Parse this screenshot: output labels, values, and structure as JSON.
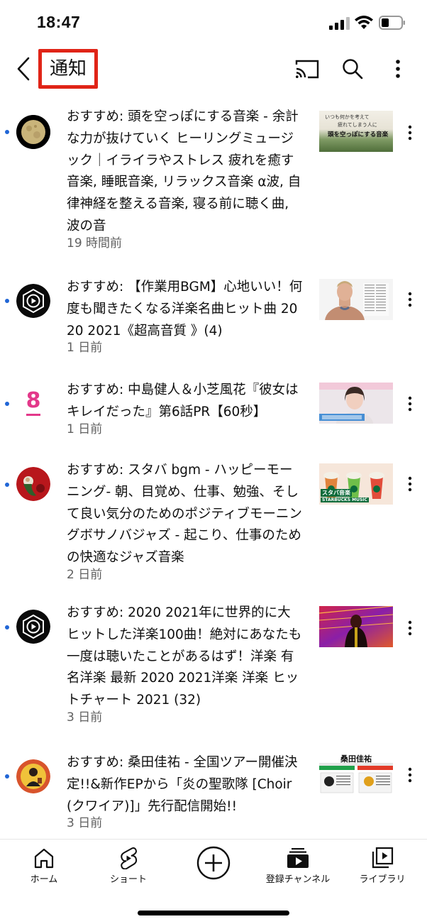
{
  "status_bar": {
    "time": "18:47"
  },
  "header": {
    "title": "通知"
  },
  "notifications": [
    {
      "text": "おすすめ: 頭を空っぽにする音楽 - 余計な力が抜けていく ヒーリングミュージック｜イライラやストレス 疲れを癒す音楽, 睡眠音楽, リラックス音楽 α波, 自律神経を整える音楽, 寝る前に聴く曲, 波の音",
      "time": "19 時間前",
      "thumb_text_1": "いつも何かを考えて",
      "thumb_text_2": "疲れてしまう人に",
      "thumb_text_3": "頭を空っぽにする音楽"
    },
    {
      "text": "おすすめ: 【作業用BGM】心地いい！何度も聞きたくなる洋楽名曲ヒット曲 2020 2021《超高音質 》(4)",
      "time": "1 日前"
    },
    {
      "text": "おすすめ: 中島健人＆小芝風花『彼女はキレイだった』第6話PR【60秒】",
      "time": "1 日前",
      "avatar_text": "8"
    },
    {
      "text": "おすすめ: スタバ bgm - ハッピーモーニング- 朝、目覚め、仕事、勉強、そして良い気分のためのポジティブモーニングボサノバジャズ - 起こり、仕事のための快適なジャズ音楽",
      "time": "2 日前",
      "thumb_text_1": "スタバ音楽",
      "thumb_text_2": "STARBUCKS MUSIC"
    },
    {
      "text": "おすすめ: 2020 2021年に世界的に大ヒットした洋楽100曲！絶対にあなたも一度は聴いたことがあるはず！洋楽 有名洋楽 最新 2020 2021洋楽 洋楽 ヒットチャート 2021 (32)",
      "time": "3 日前"
    },
    {
      "text": "おすすめ: 桑田佳祐 - 全国ツアー開催決定!!&新作EPから「炎の聖歌隊 [Choir(クワイア)]」先行配信開始!!",
      "time": "3 日前",
      "thumb_text_1": "桑田佳祐"
    }
  ],
  "bottom_nav": {
    "home": "ホーム",
    "shorts": "ショート",
    "subscriptions": "登録チャンネル",
    "library": "ライブラリ"
  },
  "colors": {
    "accent_red": "#e02417",
    "unread_blue": "#2166d6",
    "secondary_text": "#606060"
  }
}
